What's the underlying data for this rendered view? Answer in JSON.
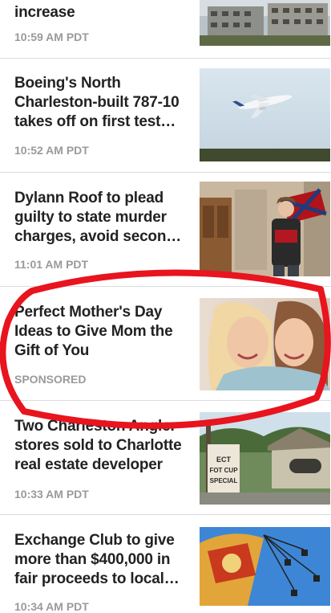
{
  "feed": {
    "items": [
      {
        "headline": "increase",
        "time": "10:59 AM PDT",
        "thumb_icon": "building-construction-photo"
      },
      {
        "headline": "Boeing's North Charleston-built 787-10 takes off on first test…",
        "time": "10:52 AM PDT",
        "thumb_icon": "airplane-in-flight-photo"
      },
      {
        "headline": "Dylann Roof to plead guilty to state murder charges, avoid secon…",
        "time": "11:01 AM PDT",
        "thumb_icon": "person-with-flag-photo"
      },
      {
        "headline": "Perfect Mother's Day Ideas to Give Mom the Gift of You",
        "time": "SPONSORED",
        "thumb_icon": "mother-daughter-hug-photo"
      },
      {
        "headline": "Two Charleston Angler stores sold to Charlotte real estate developer",
        "time": "10:33 AM PDT",
        "thumb_icon": "store-sign-photo"
      },
      {
        "headline": "Exchange Club to give more than $400,000 in fair proceeds to local…",
        "time": "10:34 AM PDT",
        "thumb_icon": "swing-ride-photo"
      }
    ]
  },
  "thumb_signs": {
    "store_sign_line1": "ECT",
    "store_sign_line2": "FOT CUP",
    "store_sign_line3": "SPECIAL"
  },
  "annotation": {
    "shape": "ellipse",
    "color": "#e8141e",
    "target_item": 3
  },
  "colors": {
    "headline": "#222222",
    "time": "#9a9a9a",
    "divider": "#dcdcdc"
  }
}
